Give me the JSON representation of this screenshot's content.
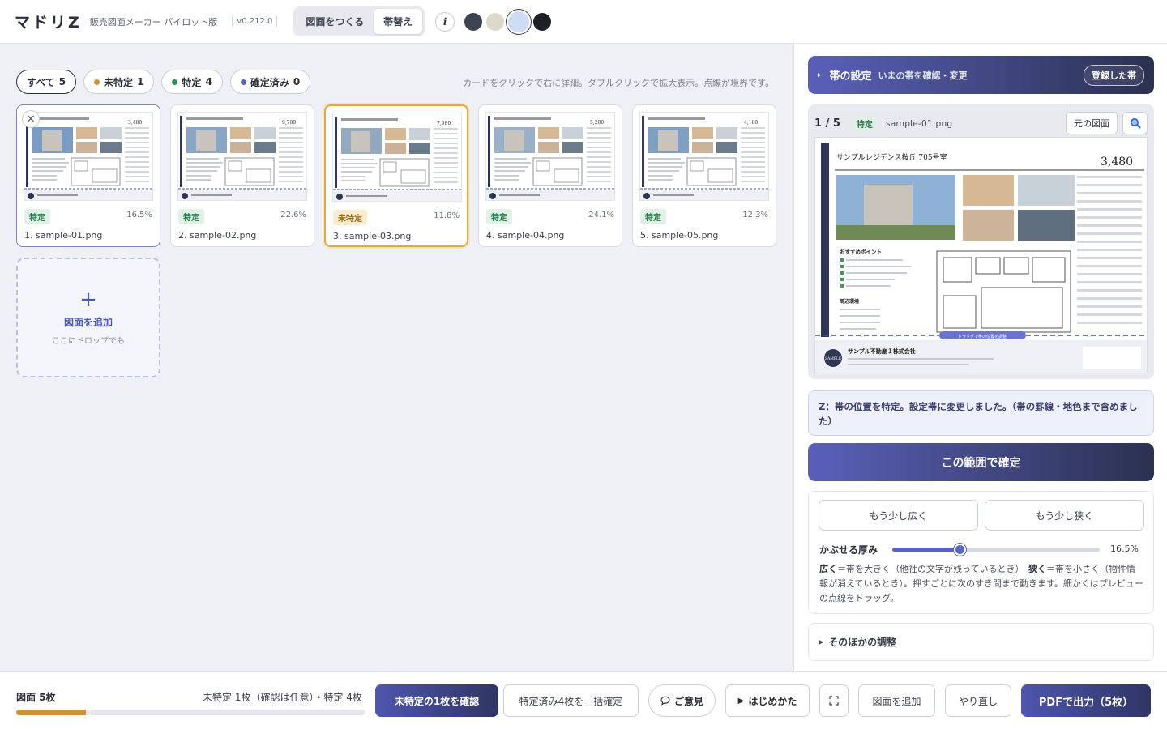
{
  "app": {
    "logo": "マドリZ",
    "tagline": "販売図面メーカー パイロット版",
    "version": "v0.212.0"
  },
  "modes": [
    {
      "label": "図面をつくる",
      "active": false
    },
    {
      "label": "帯替え",
      "active": true
    }
  ],
  "info_label": "i",
  "swatches": [
    {
      "color": "#3d4555"
    },
    {
      "color": "#ddd8cc"
    },
    {
      "color": "#cfdcf3",
      "selected": true
    },
    {
      "color": "#1d2026"
    }
  ],
  "filters": [
    {
      "label": "すべて",
      "count": "5",
      "active": true
    },
    {
      "label": "未特定",
      "count": "1",
      "dot": "#c8943a"
    },
    {
      "label": "特定",
      "count": "4",
      "dot": "#2f8a5a"
    },
    {
      "label": "確定済み",
      "count": "0",
      "dot": "#5563c4"
    }
  ],
  "hint": "カードをクリックで右に詳細。ダブルクリックで拡大表示。点線が境界です。",
  "cards": [
    {
      "badge": "特定",
      "kind": "g",
      "pct": "16.5%",
      "file": "1. sample-01.png",
      "state": "sel",
      "price": "3,480",
      "photo": "#7a9cc2"
    },
    {
      "badge": "特定",
      "kind": "g",
      "pct": "22.6%",
      "file": "2. sample-02.png",
      "state": "",
      "price": "9,780",
      "photo": "#8aa6c4"
    },
    {
      "badge": "未特定",
      "kind": "o",
      "pct": "11.8%",
      "file": "3. sample-03.png",
      "state": "warn",
      "price": "7,980",
      "photo": "#92a9c0"
    },
    {
      "badge": "特定",
      "kind": "g",
      "pct": "24.1%",
      "file": "4. sample-04.png",
      "state": "",
      "price": "5,280",
      "photo": "#9ab0c8"
    },
    {
      "badge": "特定",
      "kind": "g",
      "pct": "12.3%",
      "file": "5. sample-05.png",
      "state": "",
      "price": "4,180",
      "photo": "#7f9fc3"
    }
  ],
  "add": {
    "plus": "+",
    "label": "図面を追加",
    "sub": "ここにドロップでも"
  },
  "band": {
    "title": "帯の設定",
    "subtitle": "いまの帯を確認・変更",
    "registered": "登録した帯"
  },
  "preview": {
    "count": "1 / 5",
    "badge": "特定",
    "file": "sample-01.png",
    "orig_button": "元の図面",
    "doc_title": "サンプルレジデンス桜丘 705号室",
    "doc_price": "3,480",
    "points_title": "おすすめポイント",
    "env_title": "周辺環境",
    "company": "サンプル不動産１株式会社",
    "seal": "SAMPLE",
    "drag_label": "ドラッグで帯の位置を調整"
  },
  "status": "Z：帯の位置を特定。設定帯に変更しました。（帯の罫線・地色まで含めました）",
  "confirm": "この範囲で確定",
  "adjust": {
    "wider": "もう少し広く",
    "narrower": "もう少し狭く",
    "thickness_label": "かぶせる厚み",
    "thickness_value": "16.5%",
    "thickness": 0.165,
    "help_wide": "広く",
    "help_wide_text": "＝帯を大きく（他社の文字が残っているとき）",
    "help_narrow": "狭く",
    "help_narrow_text": "＝帯を小さく（物件情報が消えているとき）。押すごとに次のすき間まで動きます。細かくはプレビューの点線をドラッグ。"
  },
  "other": "そのほかの調整",
  "footer": {
    "count": "図面 5枚",
    "status": "未特定 1枚（確認は任意）・特定 4枚",
    "progress": 0.2,
    "confirm_unknown": "未特定の1枚を確認",
    "bulk_confirm": "特定済み4枚を一括確定",
    "feedback": "ご意見",
    "howto": "はじめかた",
    "add": "図面を追加",
    "undo": "やり直し",
    "pdf": "PDFで出力（5枚）"
  }
}
